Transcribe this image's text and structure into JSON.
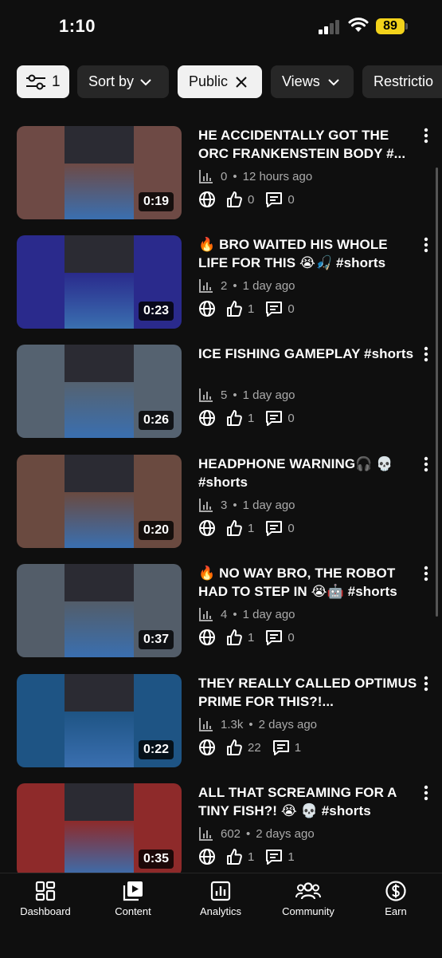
{
  "status_bar": {
    "time": "1:10",
    "battery": "89"
  },
  "filters": {
    "filter_count": "1",
    "sort_label": "Sort by",
    "visibility_label": "Public",
    "views_label": "Views",
    "restrictions_label": "Restrictio"
  },
  "videos": [
    {
      "title": "HE ACCIDENTALLY GOT THE ORC FRANKENSTEIN BODY #...",
      "views": "0",
      "age": "12 hours ago",
      "likes": "0",
      "comments": "0",
      "duration": "0:19"
    },
    {
      "title": "🔥 BRO WAITED HIS WHOLE LIFE FOR THIS 😭🎣 #shorts",
      "views": "2",
      "age": "1 day ago",
      "likes": "1",
      "comments": "0",
      "duration": "0:23"
    },
    {
      "title": "ICE FISHING GAMEPLAY #shorts",
      "views": "5",
      "age": "1 day ago",
      "likes": "1",
      "comments": "0",
      "duration": "0:26"
    },
    {
      "title": "HEADPHONE WARNING🎧 💀 #shorts",
      "views": "3",
      "age": "1 day ago",
      "likes": "1",
      "comments": "0",
      "duration": "0:20"
    },
    {
      "title": "🔥 NO WAY BRO, THE ROBOT HAD TO STEP IN 😭🤖 #shorts",
      "views": "4",
      "age": "1 day ago",
      "likes": "1",
      "comments": "0",
      "duration": "0:37"
    },
    {
      "title": "THEY REALLY CALLED OPTIMUS PRIME FOR THIS?!...",
      "views": "1.3k",
      "age": "2 days ago",
      "likes": "22",
      "comments": "1",
      "duration": "0:22"
    },
    {
      "title": "ALL THAT SCREAMING FOR A TINY FISH?! 😭 💀 #shorts",
      "views": "602",
      "age": "2 days ago",
      "likes": "1",
      "comments": "1",
      "duration": "0:35"
    }
  ],
  "thumb_colors": [
    "#6e4a45",
    "#2a2a8c",
    "#556270",
    "#6a4a40",
    "#535d69",
    "#1e5484",
    "#8e2a2a"
  ],
  "nav": {
    "dashboard": "Dashboard",
    "content": "Content",
    "analytics": "Analytics",
    "community": "Community",
    "earn": "Earn"
  },
  "icons": [
    "sliders-icon",
    "chevron-down-icon",
    "close-icon",
    "bar-chart-icon",
    "globe-icon",
    "thumbs-up-icon",
    "comment-icon",
    "more-vert-icon",
    "dashboard-icon",
    "content-icon",
    "analytics-icon",
    "community-icon",
    "earn-icon"
  ]
}
